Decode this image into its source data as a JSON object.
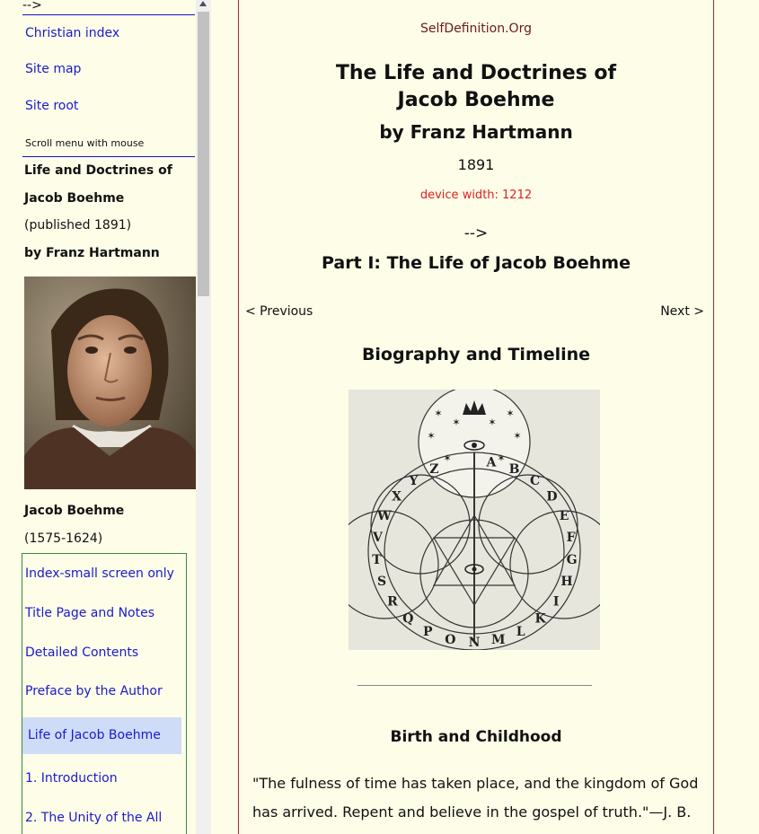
{
  "sidebar": {
    "top_arrow": "-->",
    "links": [
      "Christian index",
      "Site map",
      "Site root"
    ],
    "scroll_hint": "Scroll menu with mouse",
    "book_title_1": "Life and Doctrines of",
    "book_title_2": "Jacob Boehme",
    "published": "(published 1891)",
    "author": "by Franz Hartmann",
    "portrait_name": "Jacob Boehme",
    "portrait_dates": "(1575-1624)",
    "menu": [
      "Index-small screen only",
      "Title Page and Notes",
      "Detailed Contents",
      "Preface by the Author",
      "Life of Jacob Boehme",
      "1. Introduction",
      "2. The Unity of the All"
    ]
  },
  "main": {
    "site": "SelfDefinition.Org",
    "title_line1": "The Life and Doctrines of",
    "title_line2": "Jacob Boehme",
    "author": "by Franz Hartmann",
    "year": "1891",
    "device_width": "device width: 1212",
    "arrow": "-->",
    "part_heading": "Part I: The Life of Jacob Boehme",
    "prev": "< Previous",
    "next": "Next >",
    "section_heading": "Biography and Timeline",
    "sub_heading": "Birth and Childhood",
    "quote_line1": "\"The fulness of time has taken place, and the kingdom of God",
    "quote_line2": "has arrived. Repent and believe in the gospel of truth.\"—J. B."
  },
  "emblem_letters": [
    "A",
    "B",
    "C",
    "D",
    "E",
    "F",
    "G",
    "H",
    "I",
    "K",
    "L",
    "M",
    "N",
    "O",
    "P",
    "Q",
    "R",
    "S",
    "T",
    "V",
    "W",
    "X",
    "Y",
    "Z"
  ],
  "colors": {
    "background": "#fdfde8",
    "link": "#1a1acc",
    "device_width": "#e02020",
    "active": "#cfdcf8"
  }
}
